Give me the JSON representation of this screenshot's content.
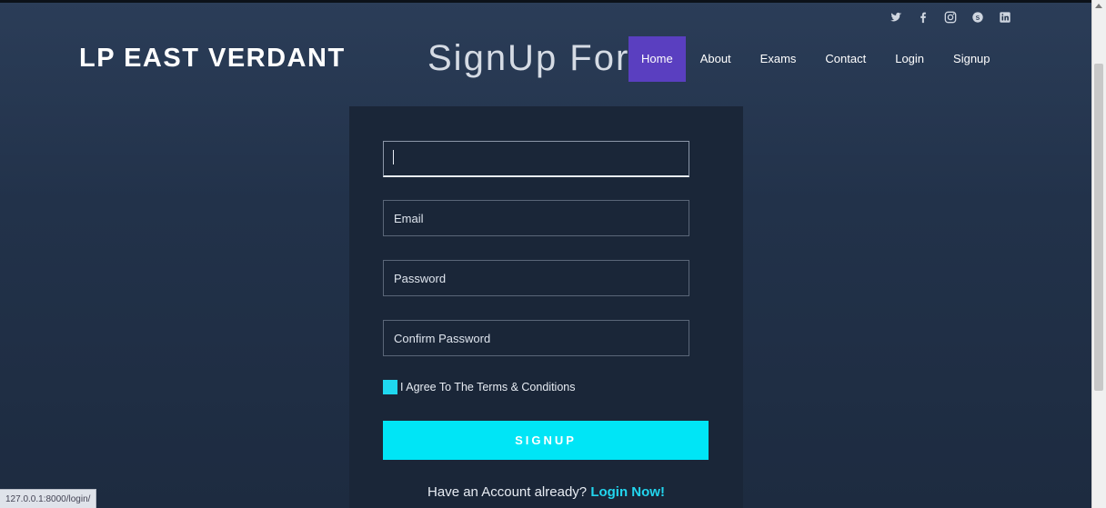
{
  "brand": {
    "logo": "LP EAST VERDANT"
  },
  "page": {
    "heading": "SignUp Form"
  },
  "nav": {
    "items": [
      {
        "label": "Home",
        "active": true
      },
      {
        "label": "About"
      },
      {
        "label": "Exams"
      },
      {
        "label": "Contact"
      },
      {
        "label": "Login"
      },
      {
        "label": "Signup"
      }
    ]
  },
  "social": [
    "twitter-icon",
    "facebook-icon",
    "instagram-icon",
    "skype-icon",
    "linkedin-icon"
  ],
  "form": {
    "username": {
      "value": "",
      "placeholder": ""
    },
    "email": {
      "placeholder": "Email"
    },
    "password": {
      "placeholder": "Password"
    },
    "confirm": {
      "placeholder": "Confirm Password"
    },
    "agree_label": "I Agree To The Terms & Conditions",
    "submit_label": "SIGNUP",
    "account_text": "Have an Account already?",
    "login_link": "Login Now!"
  },
  "status_bar": {
    "url": "127.0.0.1:8000/login/"
  },
  "colors": {
    "accent": "#00e5f6",
    "nav_active": "#5a3fc0",
    "card": "#1a2638"
  }
}
